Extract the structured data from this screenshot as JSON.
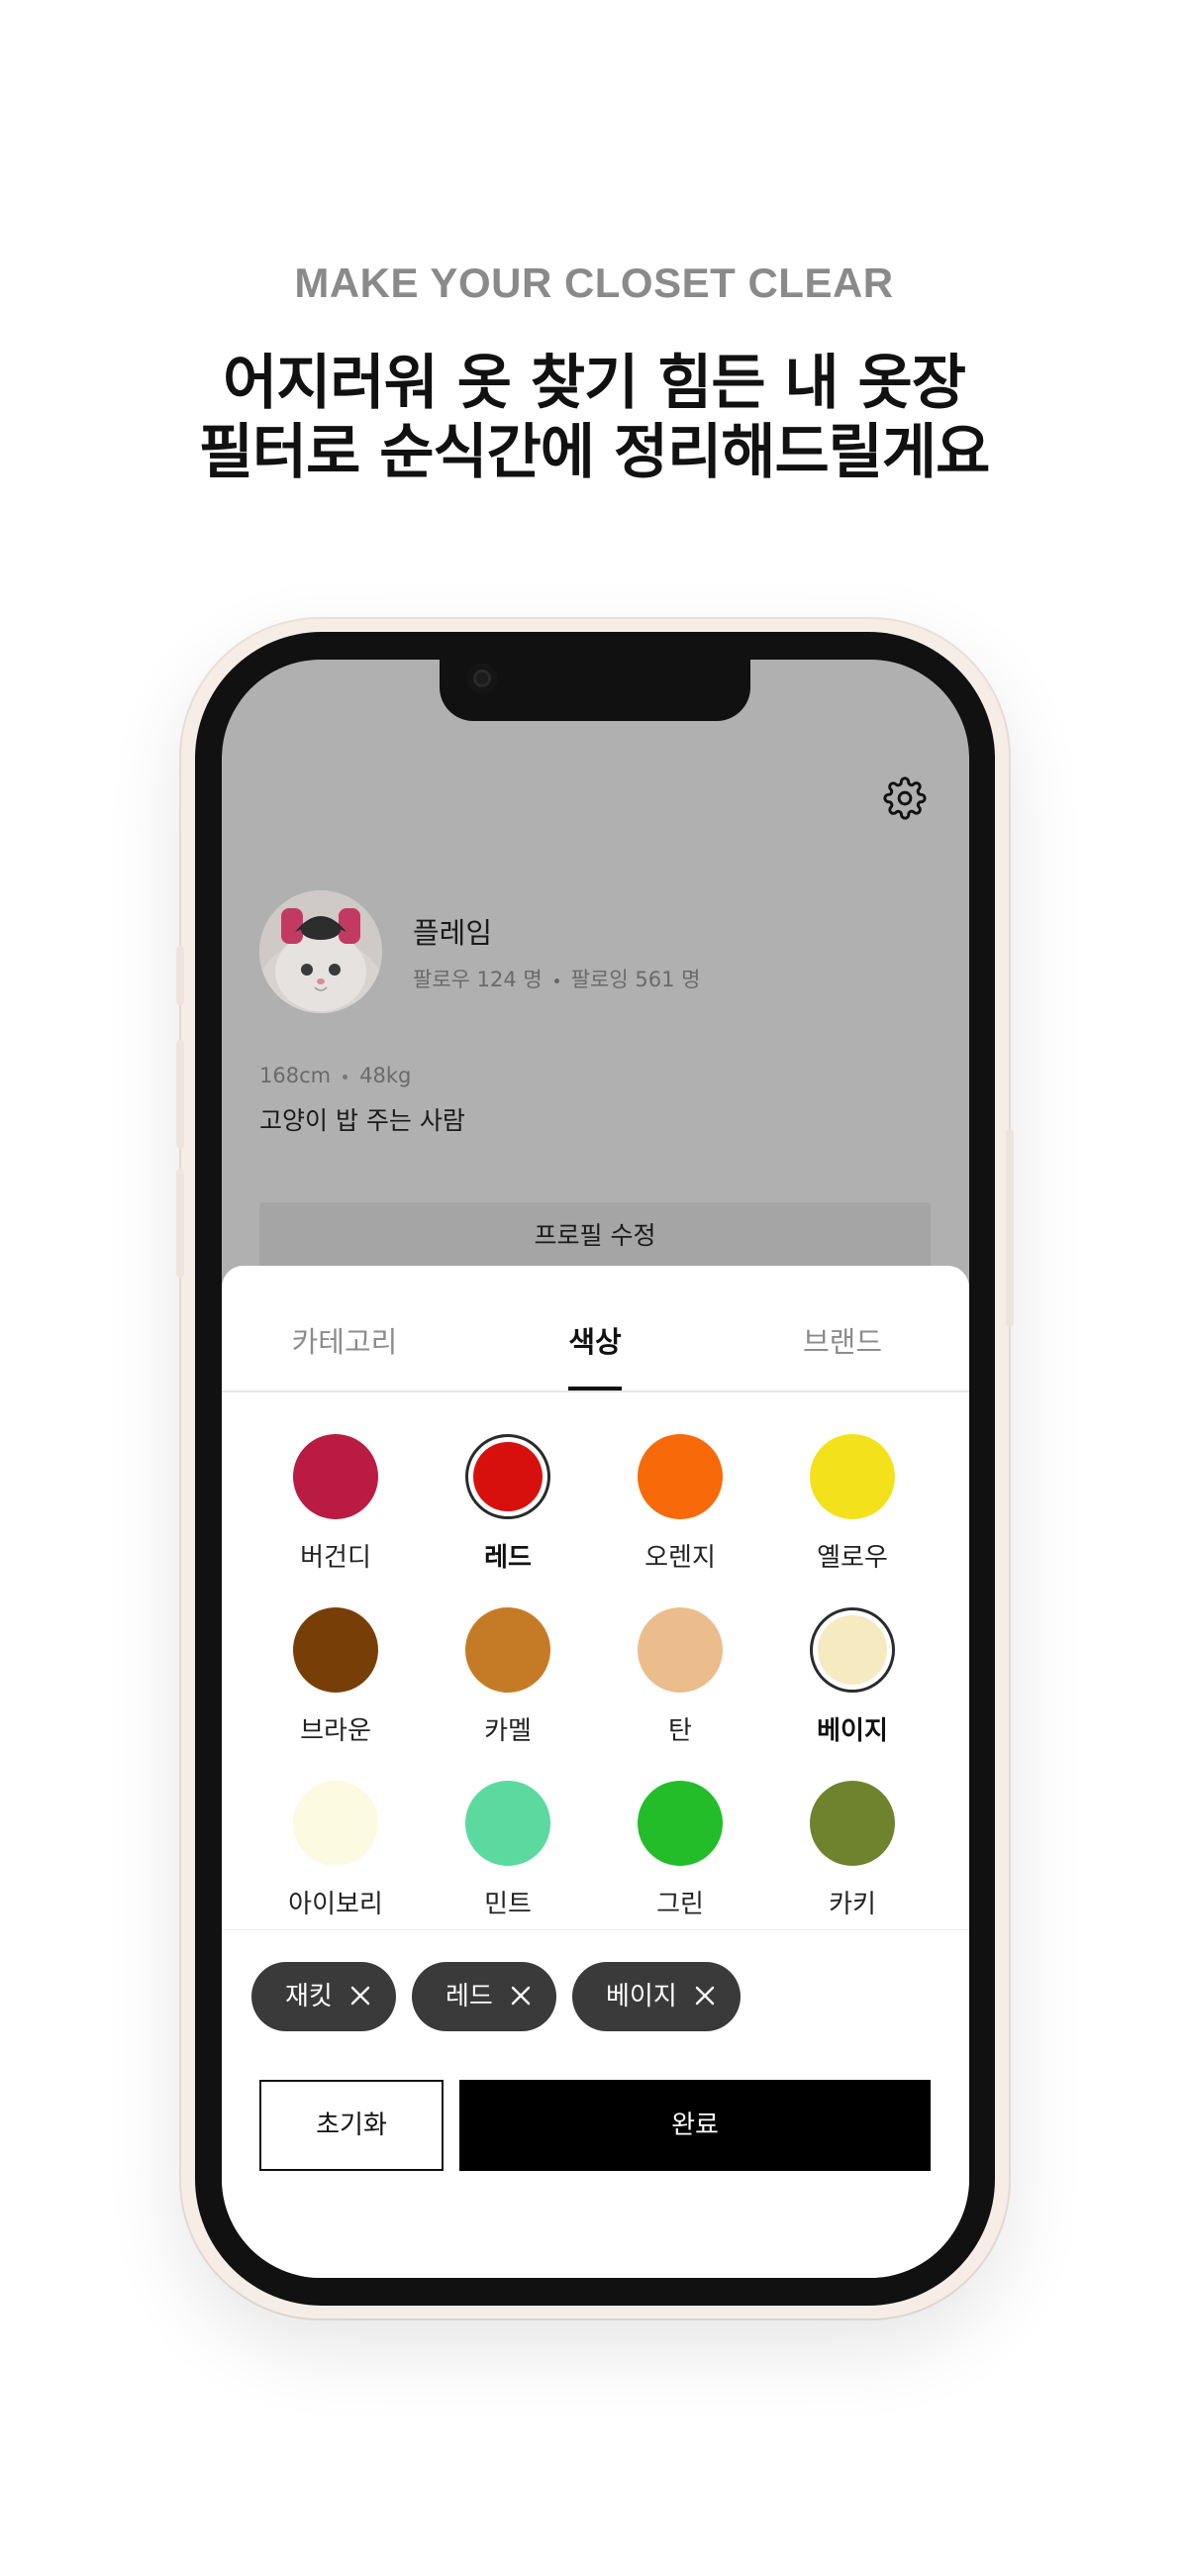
{
  "header": {
    "tagline": "MAKE YOUR CLOSET CLEAR",
    "headline_line1": "어지러워 옷 찾기 힘든 내 옷장",
    "headline_line2": "필터로 순식간에 정리해드릴게요"
  },
  "profile": {
    "name": "플레임",
    "followers": "팔로우 124 명",
    "following": "팔로잉 561 명",
    "height": "168cm",
    "weight": "48kg",
    "bio": "고양이 밥 주는 사람",
    "edit_label": "프로필 수정"
  },
  "tabs": [
    {
      "label": "카테고리",
      "active": false
    },
    {
      "label": "색상",
      "active": true
    },
    {
      "label": "브랜드",
      "active": false
    }
  ],
  "colors": [
    {
      "label": "버건디",
      "hex": "#b91b42",
      "selected": false
    },
    {
      "label": "레드",
      "hex": "#d7100e",
      "selected": true
    },
    {
      "label": "오렌지",
      "hex": "#f86909",
      "selected": false
    },
    {
      "label": "옐로우",
      "hex": "#f3e11c",
      "selected": false
    },
    {
      "label": "브라운",
      "hex": "#783e07",
      "selected": false
    },
    {
      "label": "카멜",
      "hex": "#c57b25",
      "selected": false
    },
    {
      "label": "탄",
      "hex": "#ebbd8d",
      "selected": false
    },
    {
      "label": "베이지",
      "hex": "#f6eac1",
      "selected": true
    },
    {
      "label": "아이보리",
      "hex": "#fcfbe1",
      "selected": false
    },
    {
      "label": "민트",
      "hex": "#5cd99e",
      "selected": false
    },
    {
      "label": "그린",
      "hex": "#22bd29",
      "selected": false
    },
    {
      "label": "카키",
      "hex": "#6f832f",
      "selected": false
    }
  ],
  "chips": [
    {
      "label": "재킷"
    },
    {
      "label": "레드"
    },
    {
      "label": "베이지"
    }
  ],
  "actions": {
    "reset_label": "초기화",
    "done_label": "완료"
  },
  "icons": {
    "settings": "gear-icon",
    "chip_remove": "close-icon"
  }
}
